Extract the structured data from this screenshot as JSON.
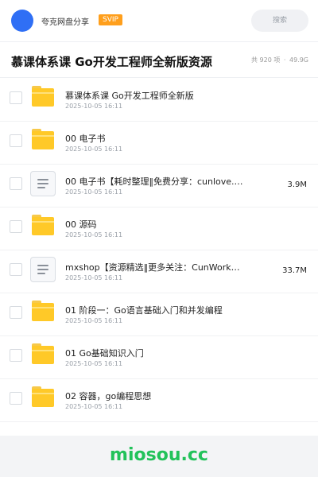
{
  "header": {
    "app_name": "夸克网盘分享",
    "badge": "SVIP",
    "search_placeholder": "搜索"
  },
  "folder": {
    "title": "慕课体系课 Go开发工程师全新版资源",
    "count_text": "共 920 项",
    "separator": "·",
    "total_size": "49.9G"
  },
  "items": [
    {
      "type": "folder",
      "name": "慕课体系课 Go开发工程师全新版",
      "date": "2025-10-05 16:11",
      "size": ""
    },
    {
      "type": "folder",
      "name": "00 电子书",
      "date": "2025-10-05 16:11",
      "size": ""
    },
    {
      "type": "file",
      "name": "00 电子书【耗时整理‖免费分享：cunlove.…",
      "date": "2025-10-05 16:11",
      "size": "3.9M"
    },
    {
      "type": "folder",
      "name": "00 源码",
      "date": "2025-10-05 16:11",
      "size": ""
    },
    {
      "type": "file",
      "name": "mxshop【资源精选‖更多关注：CunWorkN…",
      "date": "2025-10-05 16:11",
      "size": "33.7M"
    },
    {
      "type": "folder",
      "name": "01 阶段一：Go语言基础入门和并发编程",
      "date": "2025-10-05 16:11",
      "size": ""
    },
    {
      "type": "folder",
      "name": "01 Go基础知识入门",
      "date": "2025-10-05 16:11",
      "size": ""
    },
    {
      "type": "folder",
      "name": "02 容器，go编程思想",
      "date": "2025-10-05 16:11",
      "size": ""
    }
  ],
  "watermark": "miosou.cc",
  "colors": {
    "accent": "#2f6ff5",
    "badge": "#ff9f1c",
    "folder": "#ffc928",
    "watermark": "#22c25a"
  }
}
